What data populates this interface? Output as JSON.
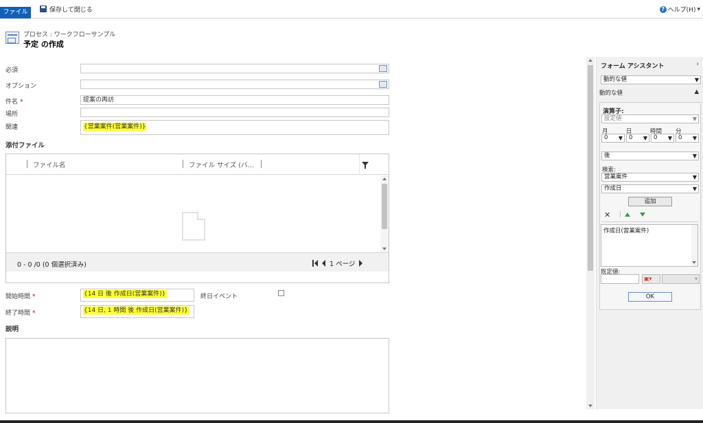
{
  "toolbar": {
    "file_tab": "ファイル",
    "save_close": "保存して閉じる",
    "help": "ヘルプ(H)"
  },
  "header": {
    "breadcrumb": "プロセス : ワークフローサンプル",
    "title": "予定 の作成"
  },
  "form": {
    "required_label": "必須",
    "optional_label": "オプション",
    "subject_label": "件名",
    "subject_value": "提案の再訪",
    "location_label": "場所",
    "regarding_label": "関連",
    "regarding_value": "{営業案件(営業案件)}",
    "start_label": "開始時間",
    "start_value": "{14 日 後 作成日(営業案件)}",
    "end_label": "終了時間",
    "end_value": "{14 日, 1 時間 後 作成日(営業案件)}",
    "allday_label": "終日イベント",
    "description_label": "説明",
    "required_mark": "*"
  },
  "attachments": {
    "title": "添付ファイル",
    "columns": [
      "ファイル名",
      "ファイル サイズ (バ…"
    ],
    "record_count": "0 - 0 /0 (0 個選択済み)",
    "page_label": "1 ページ"
  },
  "panel": {
    "title": "フォーム アシスタント",
    "dynamic_select": "動的な値",
    "dynamic_section": "動的な値",
    "operator_label": "演算子:",
    "operator_select": "設定値",
    "month_label": "月",
    "day_label": "日",
    "hour_label": "時間",
    "minute_label": "分",
    "month_value": "0",
    "day_value": "0",
    "hour_value": "0",
    "minute_value": "0",
    "after_select": "後",
    "search_label": "検索:",
    "entity_select": "営業案件",
    "field_select": "作成日",
    "add_button": "追加",
    "list_item": "作成日(営業案件)",
    "default_label": "既定値:",
    "ok_button": "OK"
  }
}
